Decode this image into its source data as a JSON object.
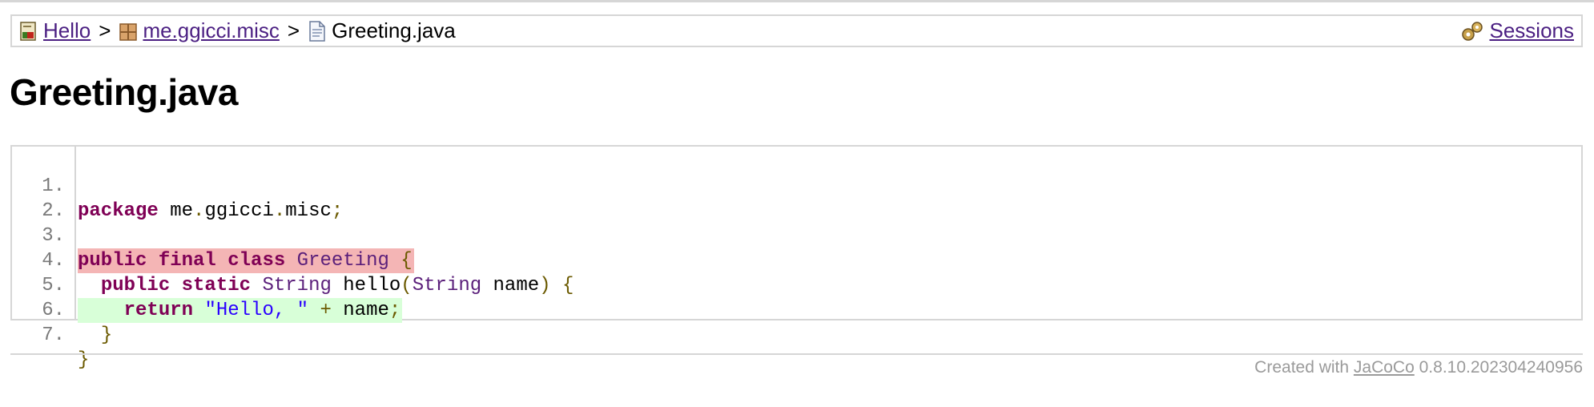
{
  "breadcrumb": {
    "items": [
      {
        "label": "Hello",
        "icon": "report-icon"
      },
      {
        "label": "me.ggicci.misc",
        "icon": "package-icon"
      }
    ],
    "separator": ">",
    "current": {
      "label": "Greeting.java",
      "icon": "source-file-icon"
    },
    "sessions": {
      "label": "Sessions",
      "icon": "gears-icon"
    }
  },
  "page_title": "Greeting.java",
  "source": {
    "lines": [
      {
        "num": "1.",
        "text": "package me.ggicci.misc;",
        "coverage": "none"
      },
      {
        "num": "2.",
        "text": "",
        "coverage": "none"
      },
      {
        "num": "3.",
        "text": "public final class Greeting {",
        "coverage": "not-covered"
      },
      {
        "num": "4.",
        "text": "  public static String hello(String name) {",
        "coverage": "none"
      },
      {
        "num": "5.",
        "text": "    return \"Hello, \" + name;",
        "coverage": "fully-covered"
      },
      {
        "num": "6.",
        "text": "  }",
        "coverage": "none"
      },
      {
        "num": "7.",
        "text": "}",
        "coverage": "none"
      }
    ]
  },
  "footer": {
    "prefix": "Created with",
    "link": "JaCoCo",
    "version": "0.8.10.202304240956"
  },
  "colors": {
    "link": "#4b1f82",
    "not_covered": "#f4b5b5",
    "fully_covered": "#d8ffd8",
    "keyword": "#7f0055",
    "string": "#2a00ff"
  }
}
